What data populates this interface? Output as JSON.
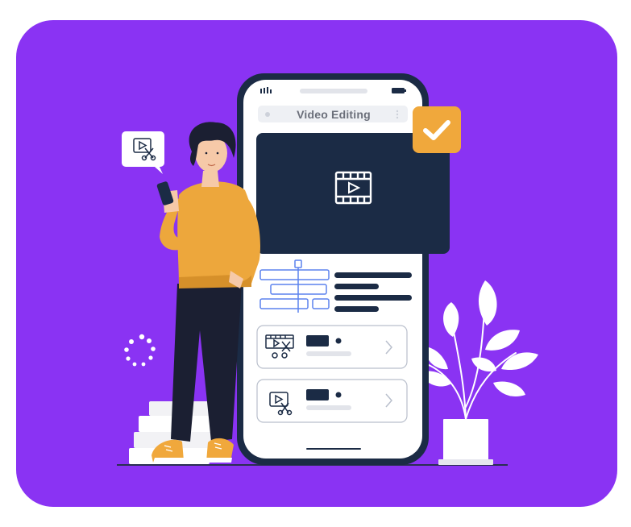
{
  "phone": {
    "app_title": "Video Editing"
  },
  "colors": {
    "background": "#8a33f3",
    "accent_orange": "#f0a83c",
    "navy": "#1b2b45",
    "timeline_blue": "#5b82ee",
    "sweater": "#eda73c"
  },
  "icons": {
    "speech_bubble": "video-edit-icon",
    "preview": "film-play-icon",
    "check_badge": "check-icon",
    "list_item_1": "clapper-scissors-icon",
    "list_item_2": "video-edit-icon",
    "chevron": "chevron-right-icon"
  }
}
